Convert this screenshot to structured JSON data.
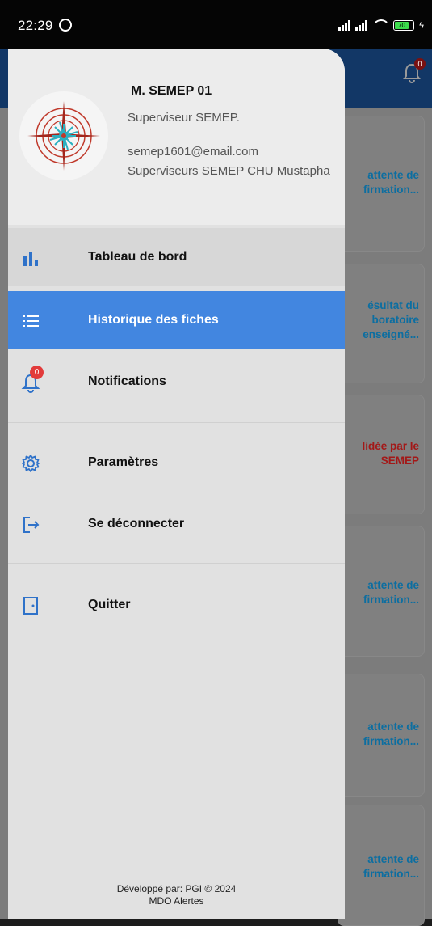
{
  "status_bar": {
    "time": "22:29",
    "battery": "70"
  },
  "header": {
    "notification_badge": "0"
  },
  "cards": [
    {
      "status": "attente de\nfirmation...",
      "color": "#0c6ea1"
    },
    {
      "status": "ésultat du\nboratoire\nenseigné...",
      "color": "#0c6ea1"
    },
    {
      "status": "lidée par le\nSEMEP",
      "color": "#a31818"
    },
    {
      "status": "attente de\nfirmation...",
      "color": "#0c6ea1"
    },
    {
      "status": "attente de\nfirmation...",
      "color": "#0c6ea1"
    },
    {
      "status": "attente de\nfirmation...",
      "color": "#0c6ea1"
    }
  ],
  "profile": {
    "name": "M. SEMEP 01",
    "role": "Superviseur SEMEP.",
    "email": "semep1601@email.com",
    "organization": "Superviseurs SEMEP CHU Mustapha"
  },
  "menu": [
    {
      "label": "Tableau de bord",
      "icon": "bar-chart-icon"
    },
    {
      "label": "Historique des fiches",
      "icon": "list-icon",
      "active": true
    },
    {
      "label": "Notifications",
      "icon": "bell-icon",
      "badge": "0"
    },
    {
      "label": "Paramètres",
      "icon": "gear-icon"
    },
    {
      "label": "Se déconnecter",
      "icon": "logout-icon"
    },
    {
      "label": "Quitter",
      "icon": "exit-door-icon"
    }
  ],
  "footer": {
    "line1": "Développé par: PGI © 2024",
    "line2": "MDO Alertes"
  },
  "colors": {
    "accent": "#4286e0",
    "header_bg": "#123766",
    "badge": "#e23b3b"
  }
}
